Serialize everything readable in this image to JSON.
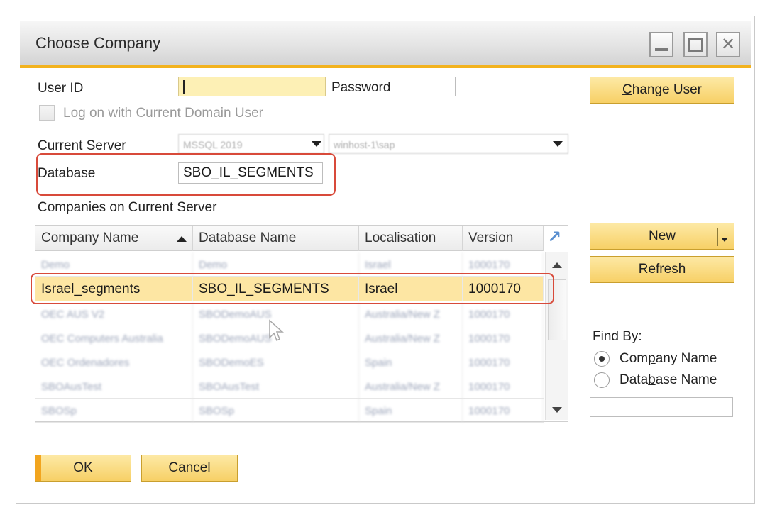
{
  "window": {
    "title": "Choose Company",
    "controls": {
      "minimize": "minimize-icon",
      "maximize": "maximize-icon",
      "close": "close-icon"
    }
  },
  "login": {
    "user_id_label": "User ID",
    "user_id_value": "",
    "password_label": "Password",
    "password_value": "",
    "logon_domain_label": "Log on with Current Domain User",
    "logon_domain_checked": false
  },
  "server": {
    "current_server_label": "Current Server",
    "server_type_value": "MSSQL 2019",
    "server_name_value": "winhost-1\\sap",
    "database_label": "Database",
    "database_value": "SBO_IL_SEGMENTS"
  },
  "companies": {
    "section_label": "Companies on Current Server",
    "columns": [
      "Company Name",
      "Database Name",
      "Localisation",
      "Version"
    ],
    "rows": [
      {
        "company": "Demo",
        "database": "Demo",
        "localisation": "Israel",
        "version": "1000170",
        "blurred": true
      },
      {
        "company": "Israel_segments",
        "database": "SBO_IL_SEGMENTS",
        "localisation": "Israel",
        "version": "1000170",
        "blurred": false,
        "selected": true
      },
      {
        "company": "OEC AUS V2",
        "database": "SBODemoAUS",
        "localisation": "Australia/New Z",
        "version": "1000170",
        "blurred": true
      },
      {
        "company": "OEC Computers Australia",
        "database": "SBODemoAUS",
        "localisation": "Australia/New Z",
        "version": "1000170",
        "blurred": true
      },
      {
        "company": "OEC Ordenadores",
        "database": "SBODemoES",
        "localisation": "Spain",
        "version": "1000170",
        "blurred": true
      },
      {
        "company": "SBOAusTest",
        "database": "SBOAusTest",
        "localisation": "Australia/New Z",
        "version": "1000170",
        "blurred": true
      },
      {
        "company": "SBOSp",
        "database": "SBOSp",
        "localisation": "Spain",
        "version": "1000170",
        "blurred": true
      }
    ]
  },
  "buttons": {
    "change_user_pre": "",
    "change_user_ul": "C",
    "change_user_post": "hange User",
    "new_label": "New",
    "refresh_ul": "R",
    "refresh_post": "efresh",
    "ok_label": "OK",
    "cancel_label": "Cancel"
  },
  "find_by": {
    "label": "Find By:",
    "options": [
      {
        "pre": "Com",
        "ul": "p",
        "post": "any Name",
        "selected": true
      },
      {
        "pre": "Data",
        "ul": "b",
        "post": "ase Name",
        "selected": false
      }
    ],
    "search_value": ""
  },
  "colors": {
    "accent": "#f2b21e",
    "button_fill": "#f7d066",
    "selected_row": "#fde6a3",
    "annotation": "#d84a3a"
  }
}
